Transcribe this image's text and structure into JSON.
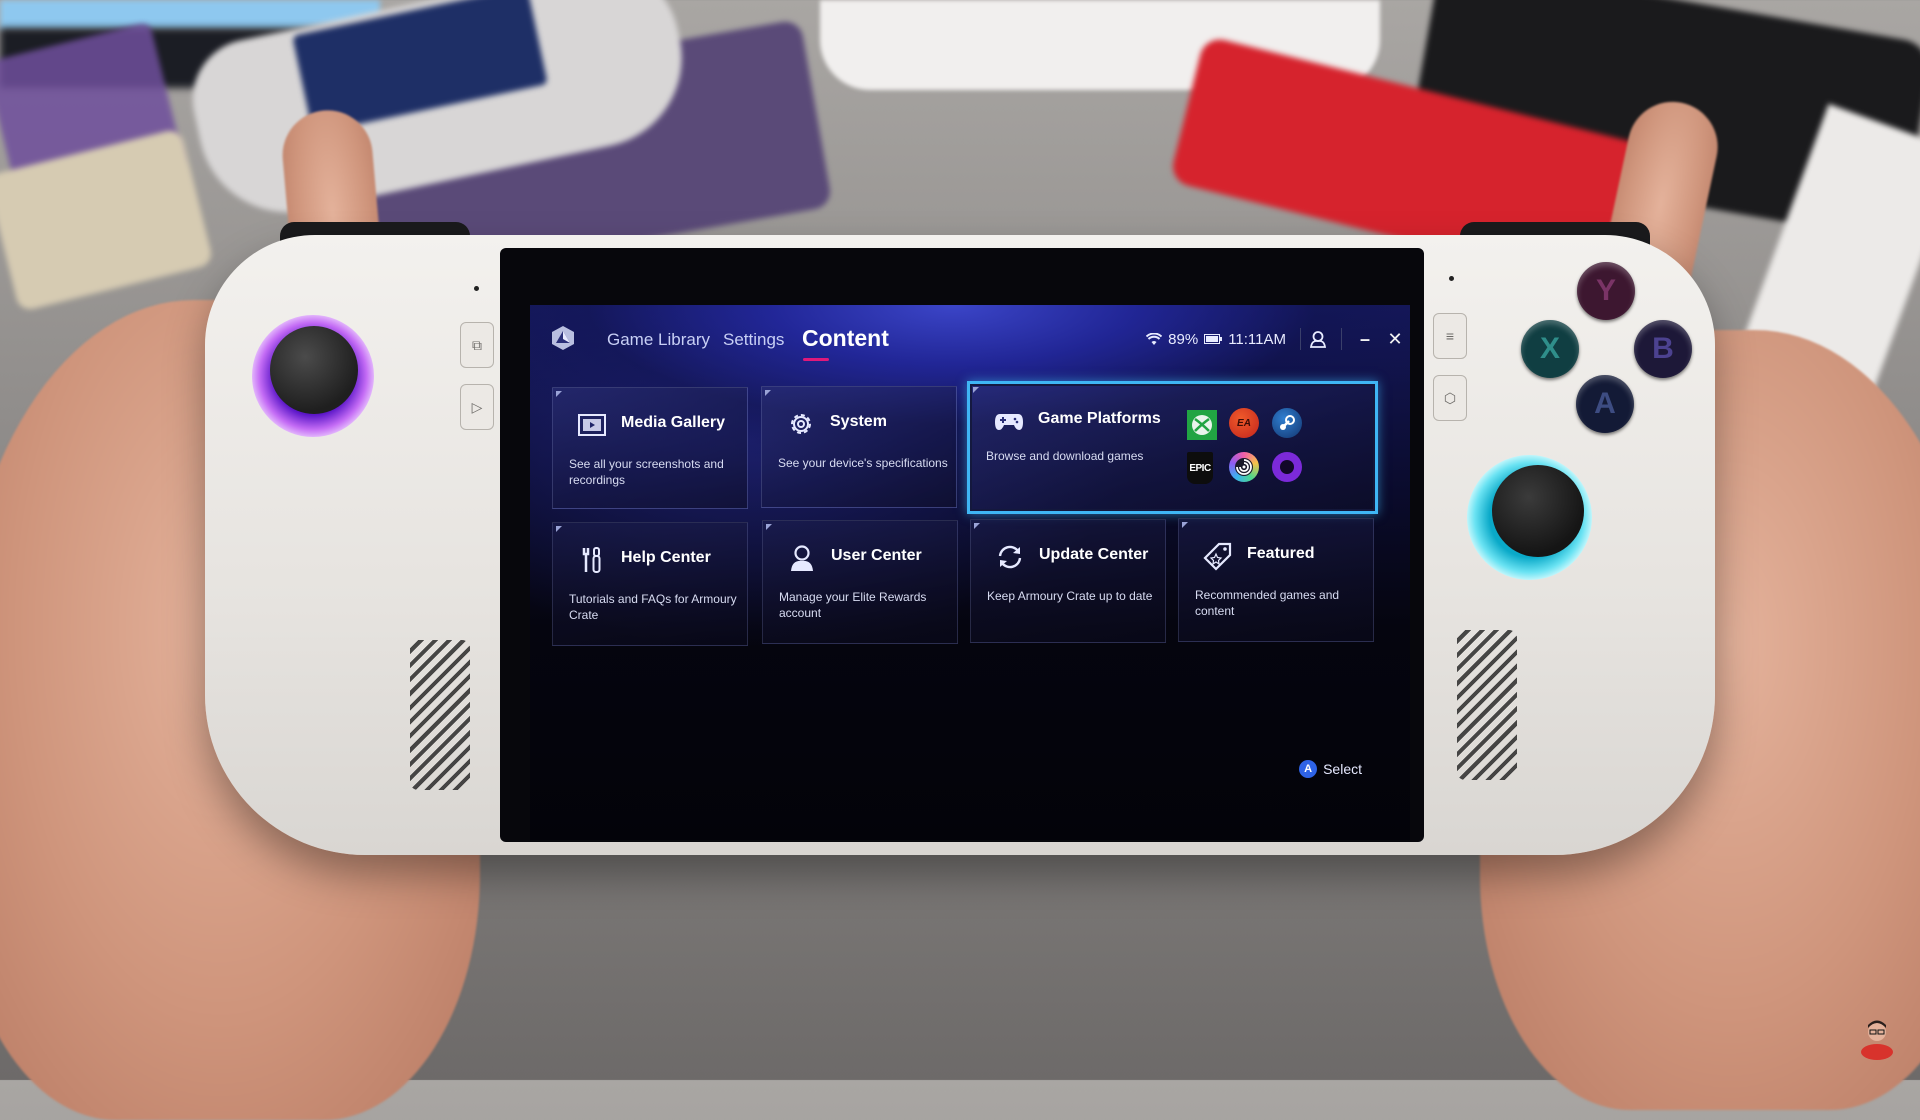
{
  "app": {
    "tabs": [
      {
        "label": "Game Library",
        "active": false
      },
      {
        "label": "Settings",
        "active": false
      },
      {
        "label": "Content",
        "active": true
      }
    ],
    "status": {
      "wifi_icon": "wifi-icon",
      "battery_percent": "89%",
      "battery_icon": "battery-icon",
      "time": "11:11AM",
      "profile_icon": "user-icon",
      "minimize_label": "–",
      "close_label": "✕"
    },
    "cards": [
      {
        "title": "Media Gallery",
        "description": "See all your screenshots and recordings",
        "icon": "media-gallery-icon"
      },
      {
        "title": "System",
        "description": "See your device's specifications",
        "icon": "gear-icon"
      },
      {
        "title": "Game Platforms",
        "description": "Browse and download games",
        "icon": "gamepad-icon",
        "selected": true,
        "platforms": [
          {
            "name": "Xbox",
            "label": ""
          },
          {
            "name": "EA",
            "label": "EA"
          },
          {
            "name": "Steam",
            "label": ""
          },
          {
            "name": "Epic Games",
            "label": "EPIC"
          },
          {
            "name": "Ubisoft",
            "label": ""
          },
          {
            "name": "GOG",
            "label": ""
          }
        ]
      },
      {
        "title": "Help Center",
        "description": "Tutorials and FAQs for Armoury Crate",
        "icon": "tools-icon"
      },
      {
        "title": "User Center",
        "description": "Manage your Elite Rewards account",
        "icon": "user-icon"
      },
      {
        "title": "Update Center",
        "description": "Keep Armoury Crate up to date",
        "icon": "refresh-icon"
      },
      {
        "title": "Featured",
        "description": "Recommended games and content",
        "icon": "tag-icon"
      }
    ],
    "footer": {
      "button_glyph": "A",
      "hint_label": "Select"
    },
    "accent_color": "#3fb6f5",
    "active_tab_underline_color": "#e0197a"
  },
  "device": {
    "face_buttons": [
      "Y",
      "X",
      "B",
      "A"
    ]
  }
}
